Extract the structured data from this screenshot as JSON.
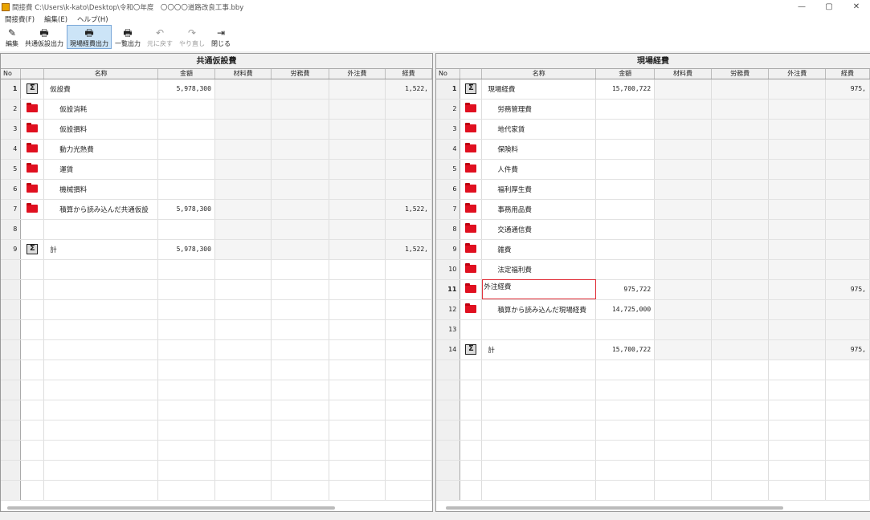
{
  "window": {
    "title": "間接費 C:\\Users\\k-kato\\Desktop\\令和〇年度　〇〇〇〇道路改良工事.bby",
    "minimize": "—",
    "maximize": "▢",
    "close": "✕"
  },
  "menu": [
    {
      "label": "間接費(F)"
    },
    {
      "label": "編集(E)"
    },
    {
      "label": "ヘルプ(H)"
    }
  ],
  "toolbar": [
    {
      "label": "編集",
      "icon": "edit-icon",
      "glyph": "✎",
      "active": false,
      "disabled": false
    },
    {
      "label": "共通仮設出力",
      "icon": "printer-icon",
      "glyph": "🖶",
      "active": false,
      "disabled": false
    },
    {
      "label": "現場経費出力",
      "icon": "printer-icon",
      "glyph": "🖶",
      "active": true,
      "disabled": false
    },
    {
      "label": "一覧出力",
      "icon": "printer-icon",
      "glyph": "🖶",
      "active": false,
      "disabled": false
    },
    {
      "label": "元に戻す",
      "icon": "undo-icon",
      "glyph": "↶",
      "active": false,
      "disabled": true
    },
    {
      "label": "やり直し",
      "icon": "redo-icon",
      "glyph": "↷",
      "active": false,
      "disabled": true
    },
    {
      "label": "閉じる",
      "icon": "exit-icon",
      "glyph": "⇥",
      "active": false,
      "disabled": false
    }
  ],
  "left_panel": {
    "title": "共通仮設費",
    "columns": [
      "No",
      "",
      "名称",
      "金額",
      "材料費",
      "労務費",
      "外注費",
      "経費"
    ],
    "rows": [
      {
        "no": "1",
        "type": "sigma",
        "name": "仮設費",
        "amount": "5,978,300",
        "keihi": "1,522,"
      },
      {
        "no": "2",
        "type": "folder",
        "name": "仮設消耗",
        "amount": "",
        "keihi": ""
      },
      {
        "no": "3",
        "type": "folder",
        "name": "仮設損料",
        "amount": "",
        "keihi": ""
      },
      {
        "no": "4",
        "type": "folder",
        "name": "動力光熱費",
        "amount": "",
        "keihi": ""
      },
      {
        "no": "5",
        "type": "folder",
        "name": "運賃",
        "amount": "",
        "keihi": ""
      },
      {
        "no": "6",
        "type": "folder",
        "name": "機械損料",
        "amount": "",
        "keihi": ""
      },
      {
        "no": "7",
        "type": "folder",
        "name": "積算から読み込んだ共通仮設",
        "amount": "5,978,300",
        "keihi": "1,522,"
      },
      {
        "no": "8",
        "type": "",
        "name": "",
        "amount": "",
        "keihi": ""
      },
      {
        "no": "9",
        "type": "sigma",
        "name": "計",
        "amount": "5,978,300",
        "keihi": "1,522,"
      }
    ]
  },
  "right_panel": {
    "title": "現場経費",
    "columns": [
      "No",
      "",
      "名称",
      "金額",
      "材料費",
      "労務費",
      "外注費",
      "経費"
    ],
    "rows": [
      {
        "no": "1",
        "type": "sigma",
        "name": "現場経費",
        "amount": "15,700,722",
        "keihi": "975,"
      },
      {
        "no": "2",
        "type": "folder",
        "name": "労務管理費",
        "amount": "",
        "keihi": ""
      },
      {
        "no": "3",
        "type": "folder",
        "name": "地代家賃",
        "amount": "",
        "keihi": ""
      },
      {
        "no": "4",
        "type": "folder",
        "name": "保険料",
        "amount": "",
        "keihi": ""
      },
      {
        "no": "5",
        "type": "folder",
        "name": "人件費",
        "amount": "",
        "keihi": ""
      },
      {
        "no": "6",
        "type": "folder",
        "name": "福利厚生費",
        "amount": "",
        "keihi": ""
      },
      {
        "no": "7",
        "type": "folder",
        "name": "事務用品費",
        "amount": "",
        "keihi": ""
      },
      {
        "no": "8",
        "type": "folder",
        "name": "交通通信費",
        "amount": "",
        "keihi": ""
      },
      {
        "no": "9",
        "type": "folder",
        "name": "雑費",
        "amount": "",
        "keihi": ""
      },
      {
        "no": "10",
        "type": "folder",
        "name": "法定福利費",
        "amount": "",
        "keihi": ""
      },
      {
        "no": "11",
        "type": "folder",
        "name": "外注経費",
        "amount": "975,722",
        "keihi": "975,",
        "editing": true
      },
      {
        "no": "12",
        "type": "folder",
        "name": "積算から読み込んだ現場経費",
        "amount": "14,725,000",
        "keihi": ""
      },
      {
        "no": "13",
        "type": "",
        "name": "",
        "amount": "",
        "keihi": ""
      },
      {
        "no": "14",
        "type": "sigma",
        "name": "計",
        "amount": "15,700,722",
        "keihi": "975,"
      }
    ]
  },
  "colors": {
    "folder": "#e01020",
    "highlight": "#e0303a",
    "active_tool": "#cce4f7"
  }
}
